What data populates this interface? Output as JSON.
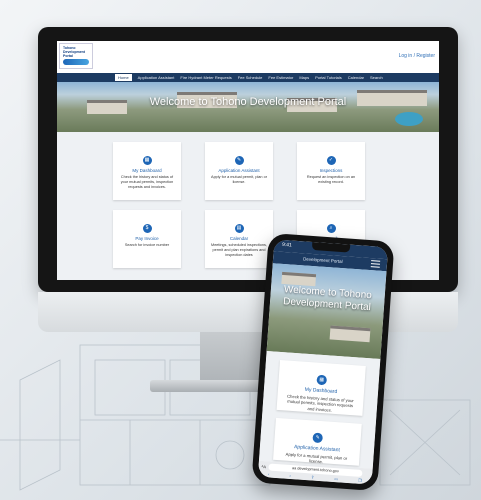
{
  "site": {
    "logo_text": "Tohono Development Portal",
    "login_link": "Log in / Register"
  },
  "nav": {
    "items": [
      "Home",
      "Application Assistant",
      "Fire Hydrant Meter Requests",
      "Fee Schedule",
      "Fee Estimator",
      "Maps",
      "Portal Tutorials",
      "Calendar",
      "Search"
    ]
  },
  "hero": {
    "title": "Welcome to Tohono Development Portal"
  },
  "cards": [
    {
      "title": "My Dashboard",
      "desc": "Check the history and status of your mutual permits, inspection requests and invoices.",
      "icon": "dashboard-icon"
    },
    {
      "title": "Application Assistant",
      "desc": "Apply for a mutual permit, plan or license.",
      "icon": "assistant-icon"
    },
    {
      "title": "Inspections",
      "desc": "Request an inspection on an existing record.",
      "icon": "inspection-icon"
    },
    {
      "title": "Pay Invoice",
      "desc": "Search for invoice number",
      "icon": "invoice-icon"
    },
    {
      "title": "Calendar",
      "desc": "Meetings, scheduled inspections, permit and plan expirations and inspection dates",
      "icon": "calendar-icon"
    },
    {
      "title": "Search",
      "desc": "Search existing permits, plans, inspections, violations, requests and invoices",
      "icon": "search-icon"
    }
  ],
  "phone": {
    "time": "9:41",
    "nav_text": "Development Portal",
    "hero_title": "Welcome to Tohono Development Portal",
    "cards": [
      {
        "title": "My Dashboard",
        "desc": "Check the history and status of your mutual permits, inspection requests and invoices."
      },
      {
        "title": "Application Assistant",
        "desc": "Apply for a mutual permit, plan or license."
      }
    ],
    "url": "aa development.tohono.gov"
  }
}
